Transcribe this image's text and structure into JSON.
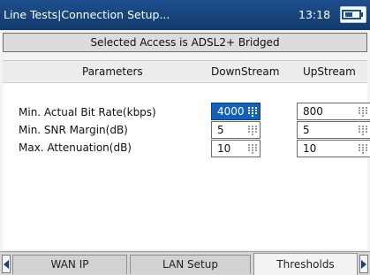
{
  "header": {
    "title": "Line Tests|Connection Setup...",
    "time": "13:18",
    "battery_icon": "battery-icon"
  },
  "access": {
    "text": "Selected Access  is ADSL2+ Bridged"
  },
  "table": {
    "columns": {
      "parameters": "Parameters",
      "downstream": "DownStream",
      "upstream": "UpStream"
    },
    "rows": [
      {
        "label": "Min. Actual Bit Rate(kbps)",
        "downstream": "4000",
        "upstream": "800"
      },
      {
        "label": "Min. SNR Margin(dB)",
        "downstream": "5",
        "upstream": "5"
      },
      {
        "label": "Max. Attenuation(dB)",
        "downstream": "10",
        "upstream": "10"
      }
    ],
    "keypad_icon": "keypad-icon"
  },
  "tabs": {
    "items": [
      {
        "label": "WAN IP"
      },
      {
        "label": "LAN Setup"
      },
      {
        "label": "Thresholds",
        "active": true
      }
    ],
    "prev_icon": "scroll-left-icon",
    "next_icon": "scroll-right-icon"
  }
}
